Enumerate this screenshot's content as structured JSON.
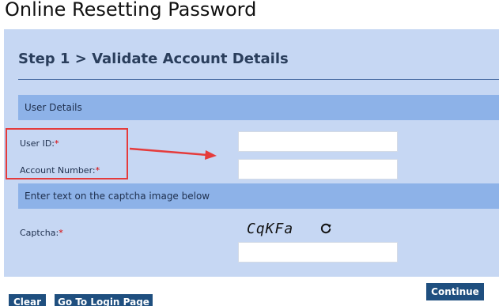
{
  "page": {
    "title": "Online Resetting Password"
  },
  "step": {
    "heading": "Step 1 > Validate Account Details"
  },
  "user_details": {
    "header": "User Details",
    "user_id": {
      "label": "User ID:",
      "required_mark": "*",
      "value": ""
    },
    "account_number": {
      "label": "Account Number:",
      "required_mark": "*",
      "value": ""
    }
  },
  "captcha_section": {
    "header": "Enter text on the captcha image below",
    "label": "Captcha:",
    "required_mark": "*",
    "image_text": "CqKFa",
    "value": ""
  },
  "annotation": {
    "highlight_color": "#e53b3b"
  },
  "buttons": {
    "continue": "Continue",
    "clear": "Clear",
    "go_to_login": "Go To Login Page"
  },
  "icons": {
    "refresh": "refresh-icon",
    "arrow": "arrow-icon"
  },
  "colors": {
    "panel_bg": "#c6d7f3",
    "section_header_bg": "#8db2e8",
    "button_bg": "#1f4f7f",
    "required": "#d90000"
  }
}
